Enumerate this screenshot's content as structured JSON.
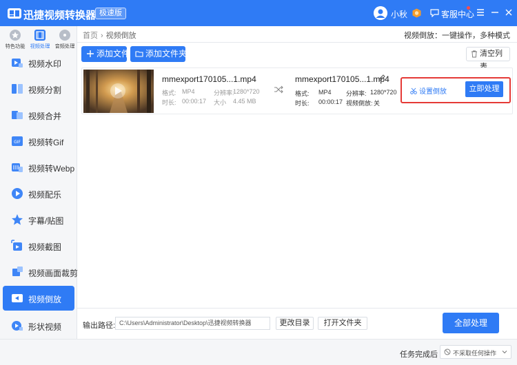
{
  "app": {
    "title": "迅捷视频转换器",
    "badge": "极速版",
    "user_name": "小秋",
    "service_label": "客服中心"
  },
  "category_tabs": [
    {
      "label": "特色功能",
      "icon": "star-icon"
    },
    {
      "label": "视频处理",
      "icon": "video-film-icon"
    },
    {
      "label": "音频处理",
      "icon": "audio-disc-icon"
    }
  ],
  "nav": [
    {
      "label": "视频水印",
      "icon": "watermark-icon"
    },
    {
      "label": "视频分割",
      "icon": "split-icon"
    },
    {
      "label": "视频合并",
      "icon": "merge-icon"
    },
    {
      "label": "视频转Gif",
      "icon": "gif-icon"
    },
    {
      "label": "视频转Webp",
      "icon": "webp-icon"
    },
    {
      "label": "视频配乐",
      "icon": "music-icon"
    },
    {
      "label": "字幕/贴图",
      "icon": "subtitle-star-icon"
    },
    {
      "label": "视频截图",
      "icon": "screenshot-icon"
    },
    {
      "label": "视频画面裁剪",
      "icon": "crop-icon"
    },
    {
      "label": "视频倒放",
      "icon": "reverse-play-icon",
      "active": true
    },
    {
      "label": "形状视频",
      "icon": "shape-video-icon"
    }
  ],
  "breadcrumb": {
    "home": "首页",
    "sep": "›",
    "current": "视频倒放"
  },
  "tip": "视频倒放：一键操作，多种模式",
  "toolbar": {
    "add_file": "添加文件",
    "add_folder": "添加文件夹",
    "clear_list": "清空列表"
  },
  "file": {
    "src": {
      "name": "mmexport170105...1.mp4",
      "format_label": "格式:",
      "format": "MP4",
      "resolution_label": "分辨率:",
      "resolution": "1280*720",
      "duration_label": "时长:",
      "duration": "00:00:17",
      "size_label": "大小",
      "size": "4.45 MB"
    },
    "out": {
      "name": "mmexport170105...1.mp4",
      "format_label": "格式:",
      "format": "MP4",
      "resolution_label": "分辨率:",
      "resolution": "1280*720",
      "duration_label": "时长:",
      "duration": "00:00:17",
      "reverse_label": "视频倒放:",
      "reverse": "关"
    },
    "set_reverse": "设置倒放",
    "process_now": "立即处理"
  },
  "bottom": {
    "output_label": "输出路径:",
    "output_path": "C:\\Users\\Administrator\\Desktop\\迅捷视频转换器",
    "change_dir": "更改目录",
    "open_folder": "打开文件夹",
    "process_all": "全部处理"
  },
  "status": {
    "done_label": "任务完成后",
    "done_value": "不采取任何操作"
  },
  "colors": {
    "accent": "#2f7bf5",
    "highlight": "#e53935"
  }
}
